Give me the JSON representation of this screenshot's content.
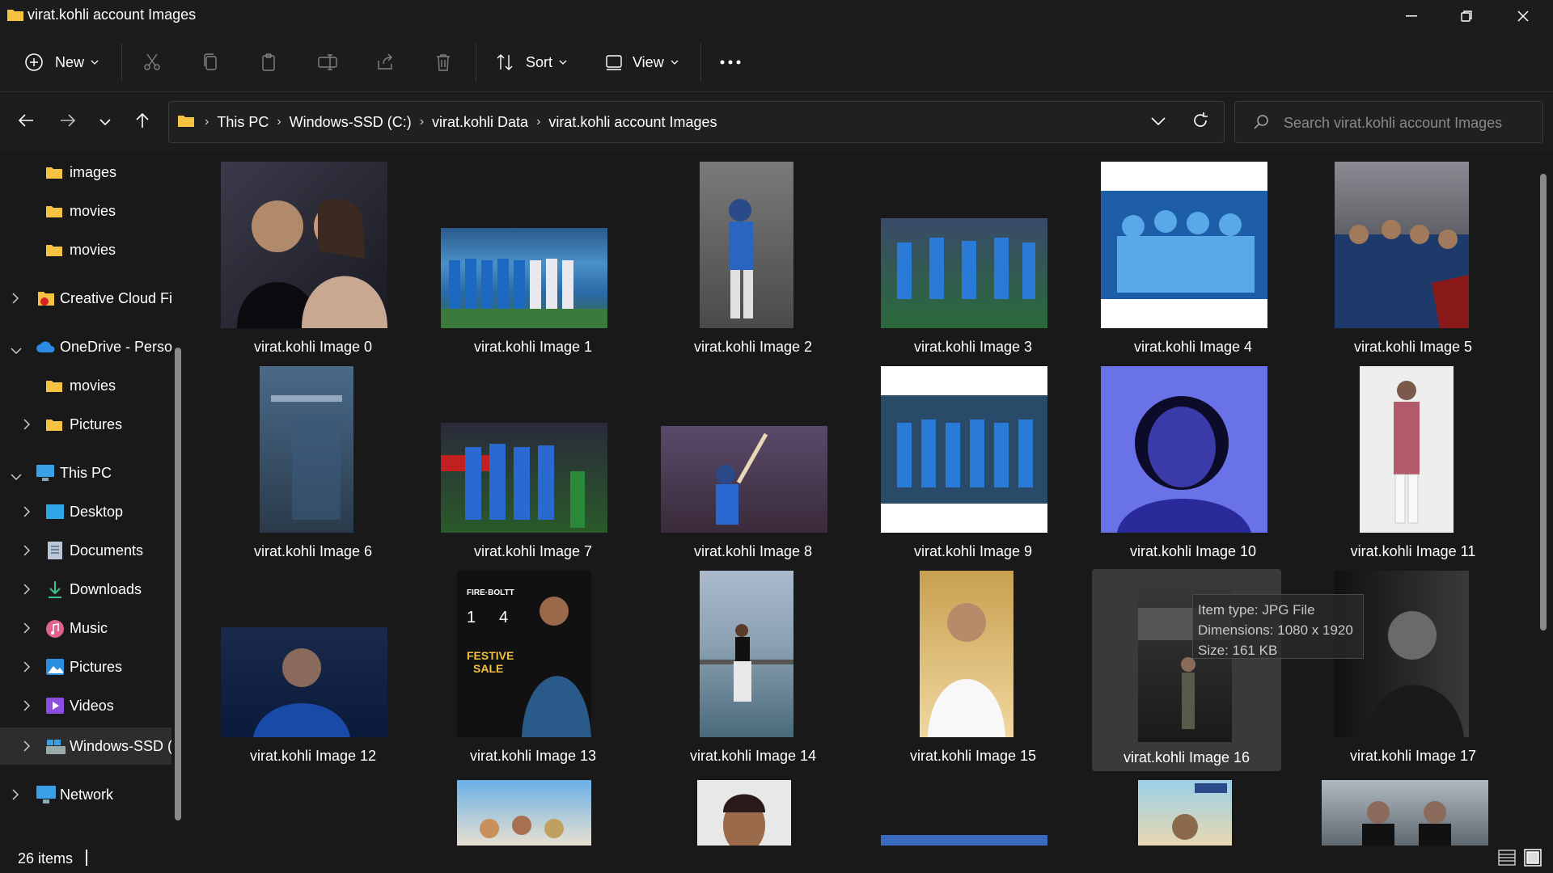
{
  "window": {
    "title": "virat.kohli account Images"
  },
  "toolbar": {
    "new_label": "New",
    "sort_label": "Sort",
    "view_label": "View"
  },
  "address": {
    "crumbs": [
      "This PC",
      "Windows-SSD (C:)",
      "virat.kohli Data",
      "virat.kohli account Images"
    ]
  },
  "search": {
    "placeholder": "Search virat.kohli account Images"
  },
  "sidebar": {
    "items": [
      {
        "label": "images",
        "icon": "folder-icon"
      },
      {
        "label": "movies",
        "icon": "folder-icon"
      },
      {
        "label": "movies",
        "icon": "folder-icon"
      },
      {
        "label": "Creative Cloud Fi",
        "icon": "creative-cloud-icon"
      },
      {
        "label": "OneDrive - Perso",
        "icon": "onedrive-icon"
      },
      {
        "label": "movies",
        "icon": "folder-icon"
      },
      {
        "label": "Pictures",
        "icon": "folder-icon"
      },
      {
        "label": "This PC",
        "icon": "this-pc-icon"
      },
      {
        "label": "Desktop",
        "icon": "desktop-icon"
      },
      {
        "label": "Documents",
        "icon": "documents-icon"
      },
      {
        "label": "Downloads",
        "icon": "downloads-icon"
      },
      {
        "label": "Music",
        "icon": "music-icon"
      },
      {
        "label": "Pictures",
        "icon": "pictures-icon"
      },
      {
        "label": "Videos",
        "icon": "videos-icon"
      },
      {
        "label": "Windows-SSD (",
        "icon": "drive-icon"
      },
      {
        "label": "Network",
        "icon": "network-icon"
      }
    ]
  },
  "files": [
    "virat.kohli Image 0",
    "virat.kohli Image 1",
    "virat.kohli Image 2",
    "virat.kohli Image 3",
    "virat.kohli Image 4",
    "virat.kohli Image 5",
    "virat.kohli Image 6",
    "virat.kohli Image 7",
    "virat.kohli Image 8",
    "virat.kohli Image 9",
    "virat.kohli Image 10",
    "virat.kohli Image 11",
    "virat.kohli Image 12",
    "virat.kohli Image 13",
    "virat.kohli Image 14",
    "virat.kohli Image 15",
    "virat.kohli Image 16",
    "virat.kohli Image 17"
  ],
  "tooltip": {
    "type": "Item type: JPG File",
    "dimensions": "Dimensions: 1080 x 1920",
    "size": "Size: 161 KB"
  },
  "status": {
    "count": "26 items"
  },
  "colors": {
    "folder": "#f5c242",
    "accent": "#4cc2ff",
    "background": "#191919"
  }
}
